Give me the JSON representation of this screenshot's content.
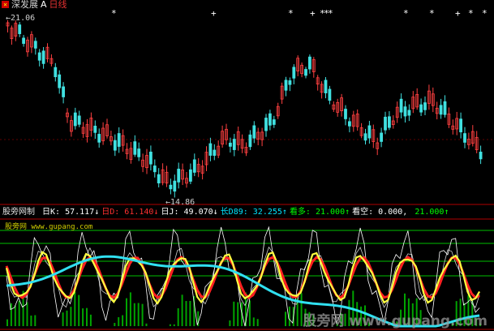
{
  "title_bar": {
    "icon": "app-icon",
    "name": "深发展",
    "flag": "A",
    "period": "日线"
  },
  "price_panel": {
    "high_label": "21.06",
    "low_label": "14.86",
    "star_marker": "*",
    "plus_marker": "+"
  },
  "indicator": {
    "name_label": "股旁网制",
    "items": [
      {
        "label": "日K:",
        "value": "57.117",
        "arrow": "↓",
        "color": "#ffffff"
      },
      {
        "label": "日D:",
        "value": "61.140",
        "arrow": "↓",
        "color": "#ff3030"
      },
      {
        "label": "日J:",
        "value": "49.070",
        "arrow": "↓",
        "color": "#ffffff"
      },
      {
        "label": "长D89:",
        "value": "32.255",
        "arrow": "↑",
        "color": "#00e5ff"
      },
      {
        "label": "看多:",
        "value": "21.000",
        "arrow": "↑",
        "color": "#00ff00"
      },
      {
        "label": "看空:",
        "value": "0.000,",
        "arrow": "",
        "color": "#ffffff"
      },
      {
        "label": "",
        "value": "21.000",
        "arrow": "↑",
        "color": "#00ff00"
      }
    ],
    "site_label": "股旁网 www.gupang.com"
  },
  "watermark": "股旁网 www.gupang.com",
  "colors": {
    "up_candle": "#ff4040",
    "down_candle": "#40e0e0",
    "k_line": "#ffffff",
    "d_line": "#ff2020",
    "j_line": "#ffffff",
    "long_line": "#30e0f0",
    "fast_line": "#ffff40",
    "green_bars": "#00c000",
    "grid_red": "#b00000",
    "guide_green": "#00c000"
  }
}
